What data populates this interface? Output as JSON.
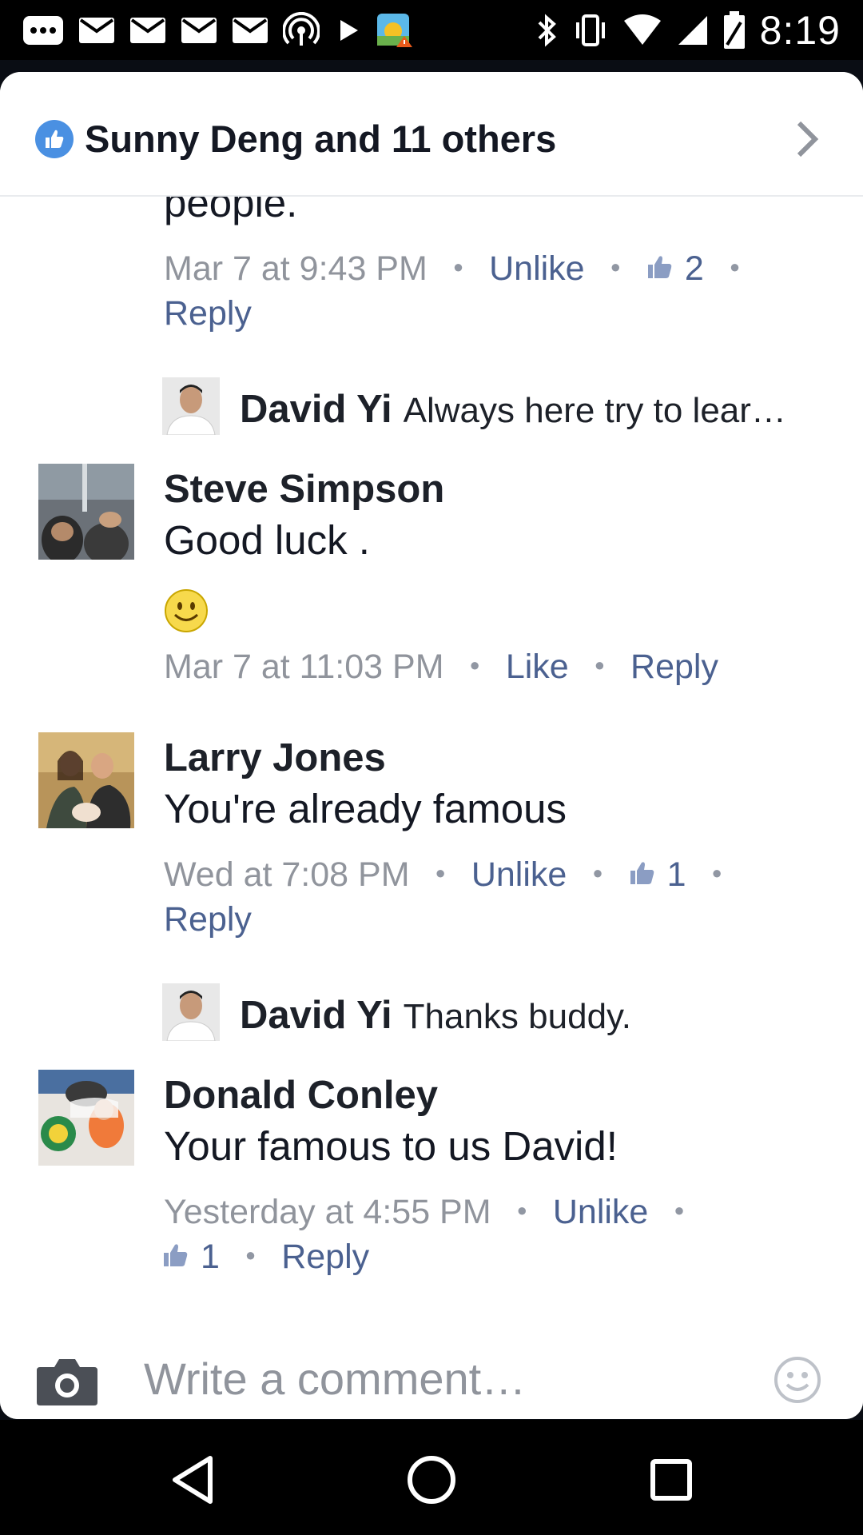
{
  "status_bar": {
    "time": "8:19",
    "left_icons": [
      "more-icon",
      "mail-icon",
      "mail-icon",
      "mail-icon",
      "mail-icon",
      "hotspot-icon",
      "play-icon",
      "weather-icon"
    ],
    "right_icons": [
      "bluetooth-icon",
      "vibrate-icon",
      "wifi-icon",
      "signal-icon",
      "battery-icon"
    ]
  },
  "header": {
    "title": "Sunny Deng and 11 others"
  },
  "comments": [
    {
      "partial_text": "people.",
      "time": "Mar 7 at 9:43 PM",
      "action": "Unlike",
      "likes": "2",
      "reply": "Reply",
      "reply_preview": {
        "name": "David Yi",
        "text": "Always here try to lear…"
      }
    },
    {
      "name": "Steve Simpson",
      "text": "Good luck .",
      "emoji": "🙂",
      "time": "Mar 7 at 11:03 PM",
      "action": "Like",
      "reply": "Reply"
    },
    {
      "name": "Larry Jones",
      "text": "You're already famous",
      "time": "Wed at 7:08 PM",
      "action": "Unlike",
      "likes": "1",
      "reply": "Reply",
      "reply_preview": {
        "name": "David Yi",
        "text": "Thanks buddy."
      }
    },
    {
      "name": "Donald Conley",
      "text": "Your famous to us David!",
      "time": "Yesterday at 4:55 PM",
      "action": "Unlike",
      "likes": "1",
      "reply": "Reply"
    }
  ],
  "composer": {
    "placeholder": "Write a comment…"
  },
  "colors": {
    "link": "#4b6190",
    "meta": "#90949c",
    "like_badge": "#4a90e2"
  }
}
